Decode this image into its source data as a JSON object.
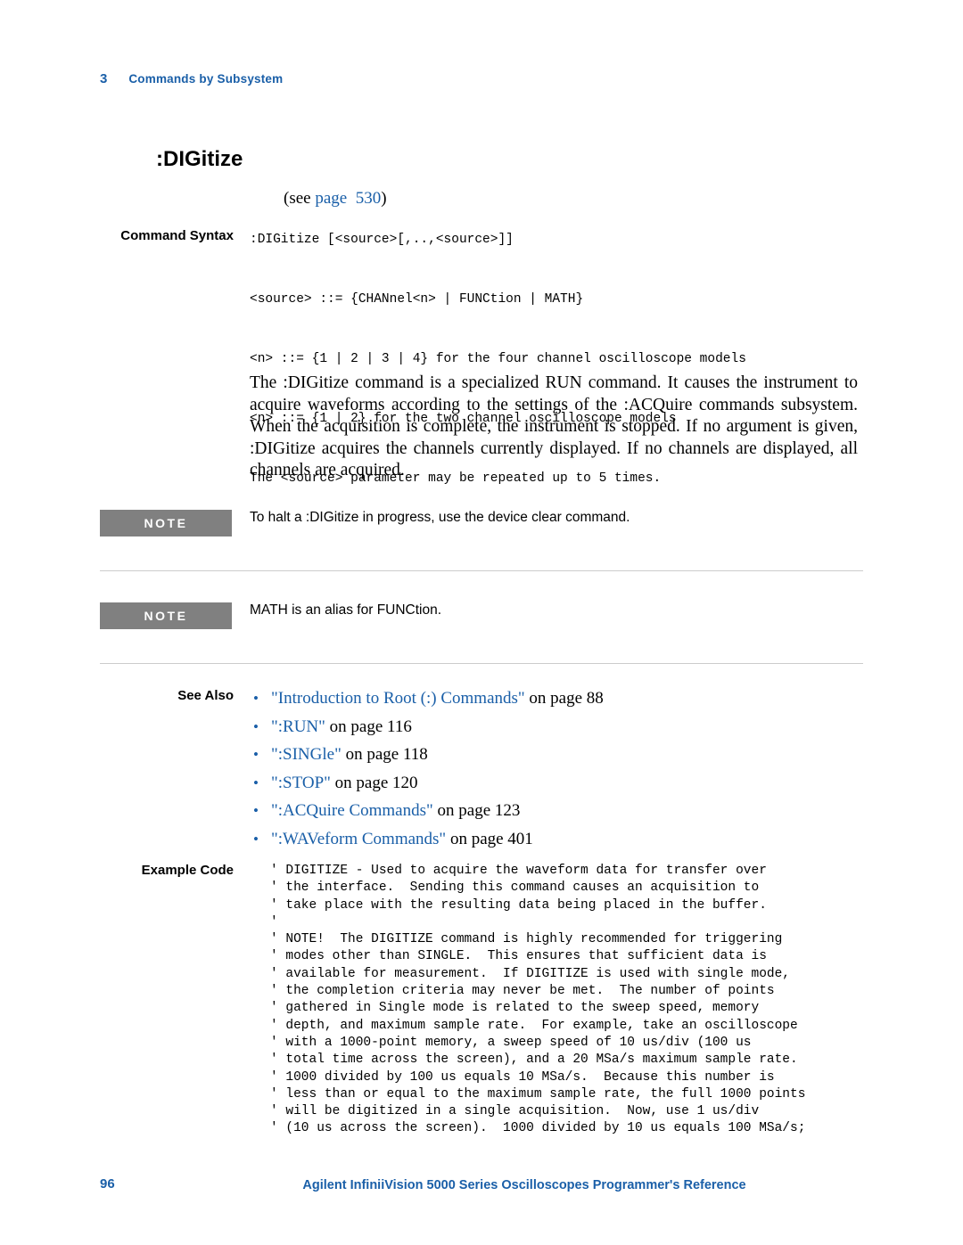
{
  "header": {
    "chapter": "3",
    "title": "Commands by Subsystem"
  },
  "command": {
    "title": ":DIGitize",
    "see_prefix": "(see ",
    "see_link": "page",
    "see_number": "530",
    "see_suffix": ")"
  },
  "labels": {
    "command_syntax": "Command Syntax",
    "see_also": "See Also",
    "example_code": "Example Code",
    "note": "NOTE"
  },
  "syntax": ":DIGitize [<source>[,..,<source>]]\n\n<source> ::= {CHANnel<n> | FUNCtion | MATH}\n\n<n> ::= {1 | 2 | 3 | 4} for the four channel oscilloscope models\n\n<n> ::= {1 | 2} for the two channel oscilloscope models\n\nThe <source> parameter may be repeated up to 5 times.",
  "description": "The :DIGitize command is a specialized RUN command. It causes the instrument to acquire waveforms according to the settings of the :ACQuire commands subsystem. When the acquisition is complete, the instrument is stopped. If no argument is given, :DIGitize acquires the channels currently displayed. If no channels are displayed, all channels are acquired.",
  "notes": [
    "To halt a :DIGitize in progress, use the device clear command.",
    "MATH is an alias for FUNCtion."
  ],
  "see_also": [
    {
      "link": "\"Introduction to Root (:) Commands\"",
      "tail": " on page 88"
    },
    {
      "link": "\":RUN\"",
      "tail": " on page 116"
    },
    {
      "link": "\":SINGle\"",
      "tail": " on page 118"
    },
    {
      "link": "\":STOP\"",
      "tail": " on page 120"
    },
    {
      "link": "\":ACQuire Commands\"",
      "tail": " on page 123"
    },
    {
      "link": "\":WAVeform Commands\"",
      "tail": " on page 401"
    }
  ],
  "example_code": "' DIGITIZE - Used to acquire the waveform data for transfer over\n' the interface.  Sending this command causes an acquisition to\n' take place with the resulting data being placed in the buffer.\n'\n' NOTE!  The DIGITIZE command is highly recommended for triggering\n' modes other than SINGLE.  This ensures that sufficient data is\n' available for measurement.  If DIGITIZE is used with single mode,\n' the completion criteria may never be met.  The number of points\n' gathered in Single mode is related to the sweep speed, memory\n' depth, and maximum sample rate.  For example, take an oscilloscope\n' with a 1000-point memory, a sweep speed of 10 us/div (100 us\n' total time across the screen), and a 20 MSa/s maximum sample rate.\n' 1000 divided by 100 us equals 10 MSa/s.  Because this number is\n' less than or equal to the maximum sample rate, the full 1000 points\n' will be digitized in a single acquisition.  Now, use 1 us/div\n' (10 us across the screen).  1000 divided by 10 us equals 100 MSa/s;",
  "footer": {
    "page_number": "96",
    "title": "Agilent InfiniiVision 5000 Series Oscilloscopes Programmer's Reference"
  },
  "colors": {
    "accent": "#1a5fa8",
    "note_box": "#808080",
    "rule": "#cccccc"
  }
}
